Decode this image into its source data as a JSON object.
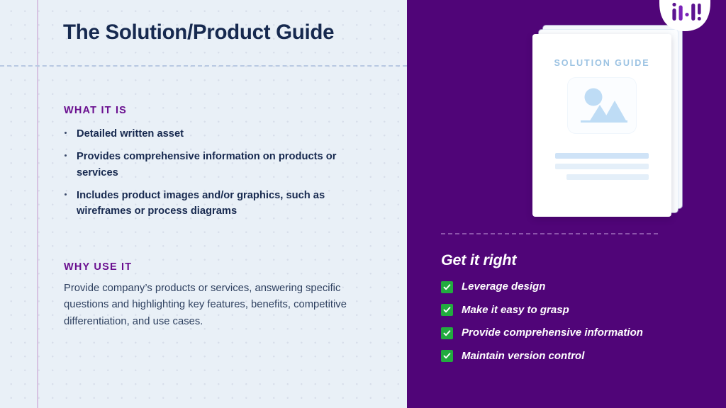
{
  "slide": {
    "title": "The Solution/Product Guide",
    "accent_purple": "#500578",
    "heading_purple": "#6a0f8f",
    "title_navy": "#16294f",
    "check_green": "#22ab3f",
    "left_bg": "#e9f0f7"
  },
  "logo": {
    "name": "imi-logo",
    "alt_text": "i|·|!"
  },
  "left": {
    "what": {
      "heading": "WHAT IT IS",
      "items": [
        "Detailed written asset",
        "Provides comprehensive information on products or services",
        "Includes product images and/or graphics, such as wireframes or process diagrams"
      ]
    },
    "why": {
      "heading": "WHY USE IT",
      "body": "Provide company’s products or services, answering specific questions and highlighting key features, benefits, competitive differentiation, and use cases."
    }
  },
  "right": {
    "document": {
      "title": "SOLUTION GUIDE",
      "image_placeholder_icon": "image-placeholder-icon",
      "text_line_count": 3
    },
    "get_it_right": {
      "heading": "Get it right",
      "items": [
        "Leverage design",
        "Make it easy to grasp",
        "Provide comprehensive information",
        "Maintain version control"
      ]
    }
  }
}
